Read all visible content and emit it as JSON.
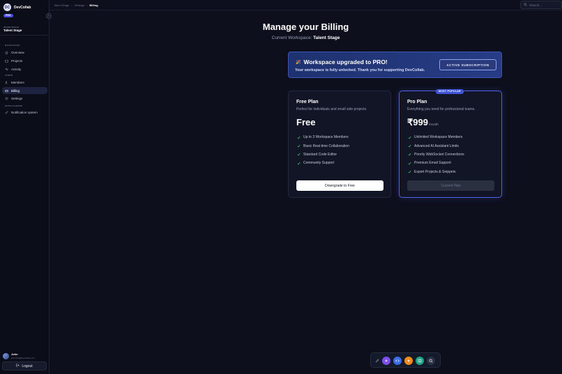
{
  "sidebar": {
    "brand_logo": "DC",
    "brand_name": "DevCollab",
    "plan_badge": "PRO",
    "workspace_label": "WORKSPACE",
    "workspace_name": "Talent Stage",
    "sections": {
      "navigation": "NAVIGATION",
      "admin": "ADMIN",
      "intelligence": "INTELLIGENCE"
    },
    "items": {
      "overview": "Overview",
      "projects": "Projects",
      "activity": "Activity",
      "members": "Members",
      "billing": "Billing",
      "settings": "Settings",
      "notification": "Notification system"
    },
    "user_name": "John",
    "user_email": "john.doe@devcollab.com",
    "logout": "Logout"
  },
  "topbar": {
    "breadcrumb": [
      "Talent Stage",
      "Settings",
      "Billing"
    ],
    "search_placeholder": "Search..."
  },
  "main": {
    "title": "Manage your Billing",
    "subtitle_prefix": "Current Workspace:",
    "subtitle_workspace": "Talent Stage",
    "banner": {
      "emoji": "🎉",
      "title": "Workspace upgraded to PRO!",
      "text": "Your workspace is fully unlocked. Thank you for supporting DevCollab.",
      "status": "ACTIVE SUBSCRIPTION"
    },
    "plans": [
      {
        "name": "Free Plan",
        "desc": "Perfect for individuals and small side projects.",
        "price": "Free",
        "features": [
          "Up to 3 Workspace Members",
          "Basic Real-time Collaboration",
          "Standard Code Editor",
          "Community Support"
        ],
        "button": "Downgrade to Free"
      },
      {
        "badge": "MOST POPULAR",
        "name": "Pro Plan",
        "desc": "Everything you need for professional teams.",
        "price": "₹999",
        "period": "/month",
        "features": [
          "Unlimited Workspace Members",
          "Advanced AI Assistant Limits",
          "Priority WebSocket Connections",
          "Premium Email Support",
          "Export Projects & Snippets"
        ],
        "button": "Current Plan"
      }
    ]
  },
  "dock": {
    "icons": [
      "pen-icon",
      "plus-icon",
      "code-icon",
      "sun-icon",
      "book-icon",
      "search-icon"
    ]
  },
  "colors": {
    "accent": "#4b4fe0",
    "check": "#3ecf6e",
    "background": "#0d0f1c"
  }
}
